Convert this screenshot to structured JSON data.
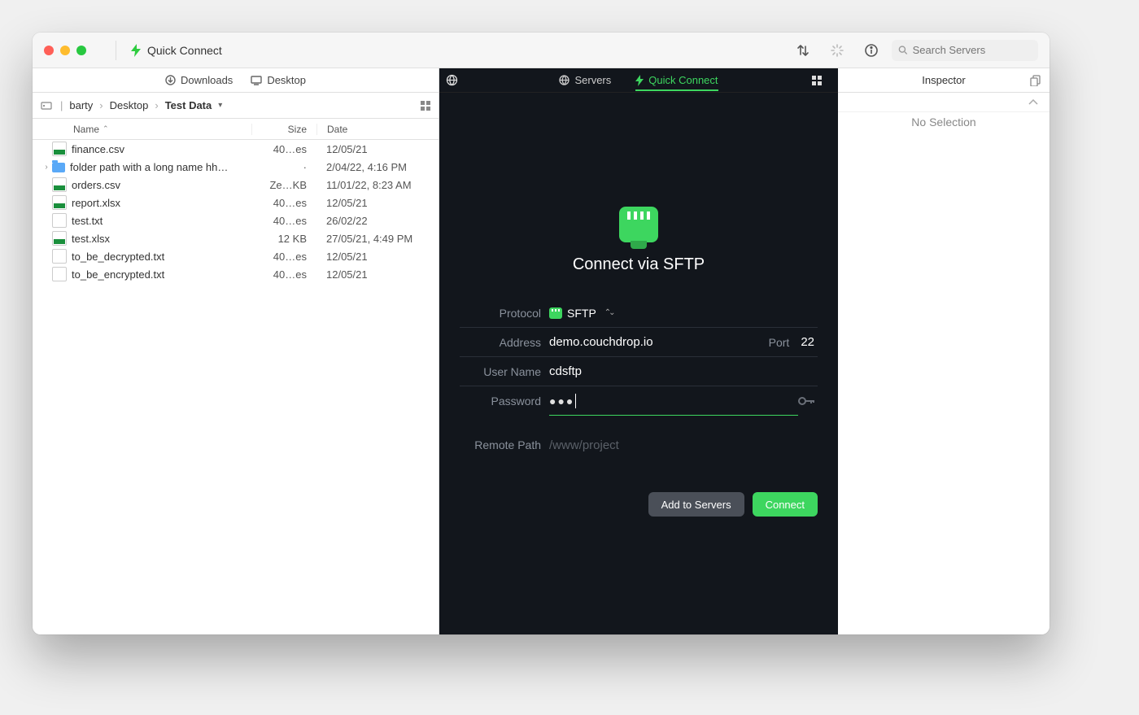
{
  "titlebar": {
    "title": "Quick Connect",
    "search_placeholder": "Search Servers"
  },
  "left": {
    "tabs": {
      "downloads": "Downloads",
      "desktop": "Desktop"
    },
    "breadcrumb": {
      "root": "barty",
      "mid": "Desktop",
      "leaf": "Test Data"
    },
    "columns": {
      "name": "Name",
      "size": "Size",
      "date": "Date"
    },
    "files": [
      {
        "icon": "xls",
        "name": "finance.csv",
        "size": "40…es",
        "date": "12/05/21",
        "expand": ""
      },
      {
        "icon": "folder",
        "name": "folder path with a long name hh…",
        "size": "·",
        "date": "2/04/22, 4:16 PM",
        "expand": "›"
      },
      {
        "icon": "xls",
        "name": "orders.csv",
        "size": "Ze…KB",
        "date": "11/01/22, 8:23 AM",
        "expand": ""
      },
      {
        "icon": "xls",
        "name": "report.xlsx",
        "size": "40…es",
        "date": "12/05/21",
        "expand": ""
      },
      {
        "icon": "txt",
        "name": "test.txt",
        "size": "40…es",
        "date": "26/02/22",
        "expand": ""
      },
      {
        "icon": "xls",
        "name": "test.xlsx",
        "size": "12 KB",
        "date": "27/05/21, 4:49 PM",
        "expand": ""
      },
      {
        "icon": "txt",
        "name": "to_be_decrypted.txt",
        "size": "40…es",
        "date": "12/05/21",
        "expand": ""
      },
      {
        "icon": "txt",
        "name": "to_be_encrypted.txt",
        "size": "40…es",
        "date": "12/05/21",
        "expand": ""
      }
    ]
  },
  "center": {
    "tabs": {
      "servers": "Servers",
      "quick_connect": "Quick Connect"
    },
    "title": "Connect via SFTP",
    "labels": {
      "protocol": "Protocol",
      "address": "Address",
      "port": "Port",
      "username": "User Name",
      "password": "Password",
      "remote_path": "Remote Path"
    },
    "values": {
      "protocol": "SFTP",
      "address": "demo.couchdrop.io",
      "port": "22",
      "username": "cdsftp",
      "password": "●●●",
      "remote_path_placeholder": "/www/project"
    },
    "buttons": {
      "add": "Add to Servers",
      "connect": "Connect"
    }
  },
  "inspector": {
    "title": "Inspector",
    "no_selection": "No Selection"
  }
}
